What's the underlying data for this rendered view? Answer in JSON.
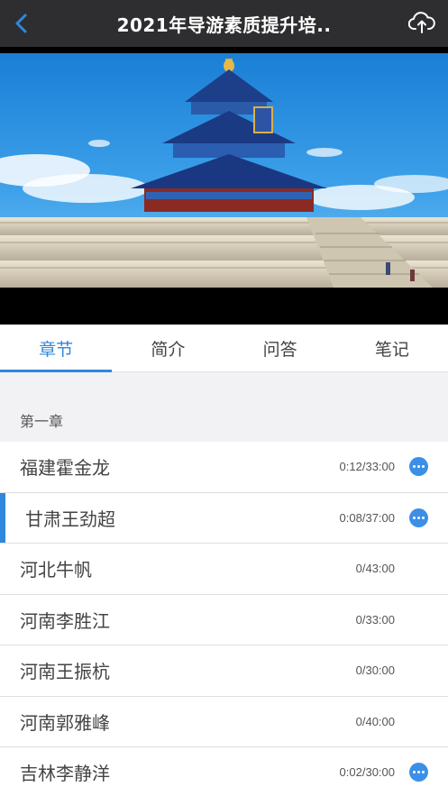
{
  "header": {
    "title": "2021年导游素质提升培..",
    "back_icon": "chevron-left-icon",
    "upload_icon": "cloud-upload-icon"
  },
  "video": {
    "subject": "Temple of Heaven"
  },
  "tabs": [
    {
      "label": "章节",
      "active": true
    },
    {
      "label": "简介",
      "active": false
    },
    {
      "label": "问答",
      "active": false
    },
    {
      "label": "笔记",
      "active": false
    }
  ],
  "chapter": {
    "title": "第一章"
  },
  "lessons": [
    {
      "title": "福建霍金龙",
      "time": "0:12/33:00",
      "has_more": true,
      "active": false
    },
    {
      "title": "甘肃王劲超",
      "time": "0:08/37:00",
      "has_more": true,
      "active": true
    },
    {
      "title": "河北牛帆",
      "time": "0/43:00",
      "has_more": false,
      "active": false
    },
    {
      "title": "河南李胜江",
      "time": "0/33:00",
      "has_more": false,
      "active": false
    },
    {
      "title": "河南王振杭",
      "time": "0/30:00",
      "has_more": false,
      "active": false
    },
    {
      "title": "河南郭雅峰",
      "time": "0/40:00",
      "has_more": false,
      "active": false
    },
    {
      "title": "吉林李静洋",
      "time": "0:02/30:00",
      "has_more": true,
      "active": false
    }
  ],
  "colors": {
    "accent": "#2f87de",
    "header_bg": "#2e2e30"
  }
}
